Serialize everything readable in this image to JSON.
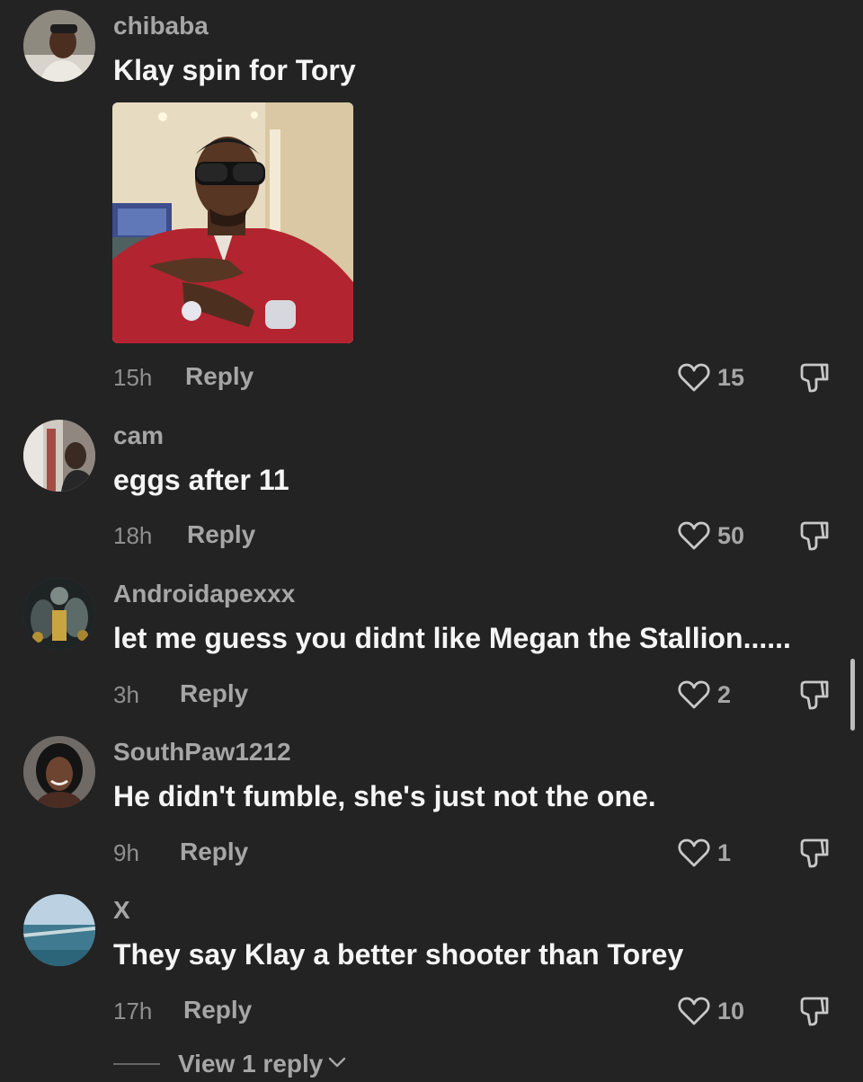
{
  "comments": [
    {
      "username": "chibaba",
      "text": "Klay spin for Tory",
      "time": "15h",
      "reply_label": "Reply",
      "likes": "15",
      "has_image": true
    },
    {
      "username": "cam",
      "text": "eggs after 11",
      "time": "18h",
      "reply_label": "Reply",
      "likes": "50"
    },
    {
      "username": "Androidapexxx",
      "text": "let me guess you didnt like Megan the Stallion......",
      "time": "3h",
      "reply_label": "Reply",
      "likes": "2"
    },
    {
      "username": "SouthPaw1212",
      "text": "He didn't fumble, she's just not the one.",
      "time": "9h",
      "reply_label": "Reply",
      "likes": "1"
    },
    {
      "username": "X",
      "text": "They say Klay a better shooter than Torey",
      "time": "17h",
      "reply_label": "Reply",
      "likes": "10"
    }
  ],
  "view_replies_label": "View 1 reply",
  "colors": {
    "background": "#232323",
    "primary_text": "#f5f5f5",
    "secondary_text": "#a6a6a6"
  },
  "icons": {
    "like": "heart-outline-icon",
    "dislike": "thumbs-down-icon",
    "expand": "chevron-down-icon"
  }
}
